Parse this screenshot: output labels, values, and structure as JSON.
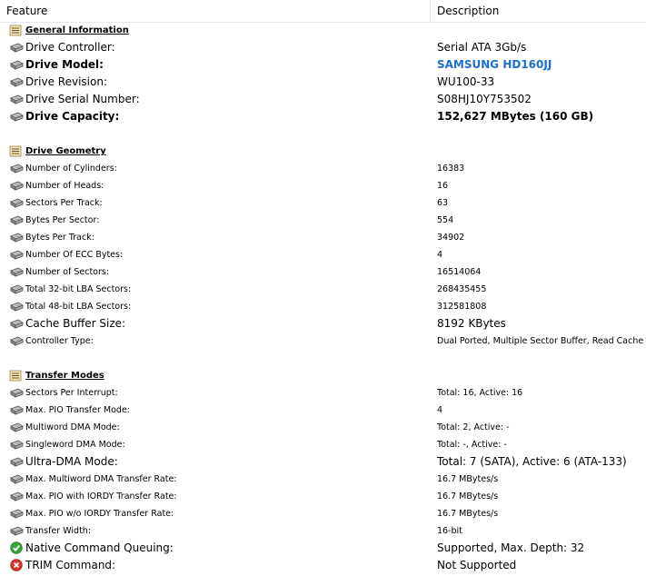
{
  "header": {
    "feature": "Feature",
    "description": "Description"
  },
  "sections": [
    {
      "title": "General Information",
      "items": [
        {
          "feature": "Drive Controller:",
          "value": "Serial ATA 3Gb/s",
          "size": "m",
          "icon": "hard-drive-icon"
        },
        {
          "feature": "Drive Model:",
          "value": "SAMSUNG HD160JJ",
          "size": "m",
          "bold": true,
          "blue": true,
          "icon": "hard-drive-icon"
        },
        {
          "feature": "Drive Revision:",
          "value": "WU100-33",
          "size": "m",
          "icon": "hard-drive-icon"
        },
        {
          "feature": "Drive Serial Number:",
          "value": "S08HJ10Y753502",
          "size": "m",
          "icon": "hard-drive-icon"
        },
        {
          "feature": "Drive Capacity:",
          "value": "152,627 MBytes (160 GB)",
          "size": "m",
          "bold": true,
          "icon": "hard-drive-icon"
        }
      ]
    },
    {
      "title": "Drive Geometry",
      "items": [
        {
          "feature": "Number of Cylinders:",
          "value": "16383",
          "size": "s",
          "icon": "hard-drive-icon"
        },
        {
          "feature": "Number of Heads:",
          "value": "16",
          "size": "s",
          "icon": "hard-drive-icon"
        },
        {
          "feature": "Sectors Per Track:",
          "value": "63",
          "size": "s",
          "icon": "hard-drive-icon"
        },
        {
          "feature": "Bytes Per Sector:",
          "value": "554",
          "size": "s",
          "icon": "hard-drive-icon"
        },
        {
          "feature": "Bytes Per Track:",
          "value": "34902",
          "size": "s",
          "icon": "hard-drive-icon"
        },
        {
          "feature": "Number Of ECC Bytes:",
          "value": "4",
          "size": "s",
          "icon": "hard-drive-icon"
        },
        {
          "feature": "Number of Sectors:",
          "value": "16514064",
          "size": "s",
          "icon": "hard-drive-icon"
        },
        {
          "feature": "Total 32-bit LBA Sectors:",
          "value": "268435455",
          "size": "s",
          "icon": "hard-drive-icon"
        },
        {
          "feature": "Total 48-bit LBA Sectors:",
          "value": "312581808",
          "size": "s",
          "icon": "hard-drive-icon"
        },
        {
          "feature": "Cache Buffer Size:",
          "value": "8192 KBytes",
          "size": "m",
          "icon": "hard-drive-icon"
        },
        {
          "feature": "Controller Type:",
          "value": "Dual Ported, Multiple Sector Buffer, Read Cache",
          "size": "s",
          "icon": "hard-drive-icon"
        }
      ]
    },
    {
      "title": "Transfer Modes",
      "items": [
        {
          "feature": "Sectors Per Interrupt:",
          "value": "Total: 16, Active: 16",
          "size": "s",
          "icon": "hard-drive-icon"
        },
        {
          "feature": "Max. PIO Transfer Mode:",
          "value": "4",
          "size": "s",
          "icon": "hard-drive-icon"
        },
        {
          "feature": "Multiword DMA Mode:",
          "value": "Total: 2, Active: -",
          "size": "s",
          "icon": "hard-drive-icon"
        },
        {
          "feature": "Singleword DMA Mode:",
          "value": "Total: -, Active: -",
          "size": "s",
          "icon": "hard-drive-icon"
        },
        {
          "feature": "Ultra-DMA Mode:",
          "value": "Total: 7 (SATA), Active: 6 (ATA-133)",
          "size": "m",
          "icon": "hard-drive-icon"
        },
        {
          "feature": "Max. Multiword DMA Transfer Rate:",
          "value": "16.7 MBytes/s",
          "size": "s",
          "icon": "hard-drive-icon"
        },
        {
          "feature": "Max. PIO with IORDY Transfer Rate:",
          "value": "16.7 MBytes/s",
          "size": "s",
          "icon": "hard-drive-icon"
        },
        {
          "feature": "Max. PIO w/o IORDY Transfer Rate:",
          "value": "16.7 MBytes/s",
          "size": "s",
          "icon": "hard-drive-icon"
        },
        {
          "feature": "Transfer Width:",
          "value": "16-bit",
          "size": "s",
          "icon": "hard-drive-icon"
        },
        {
          "feature": "Native Command Queuing:",
          "value": "Supported, Max. Depth: 32",
          "size": "m",
          "icon": "check-circle-icon"
        },
        {
          "feature": "TRIM Command:",
          "value": "Not Supported",
          "size": "m",
          "icon": "error-circle-icon"
        }
      ]
    }
  ],
  "colors": {
    "link_blue": "#1c6fd0",
    "check_green": "#3aa53a",
    "error_red": "#d9342b"
  }
}
